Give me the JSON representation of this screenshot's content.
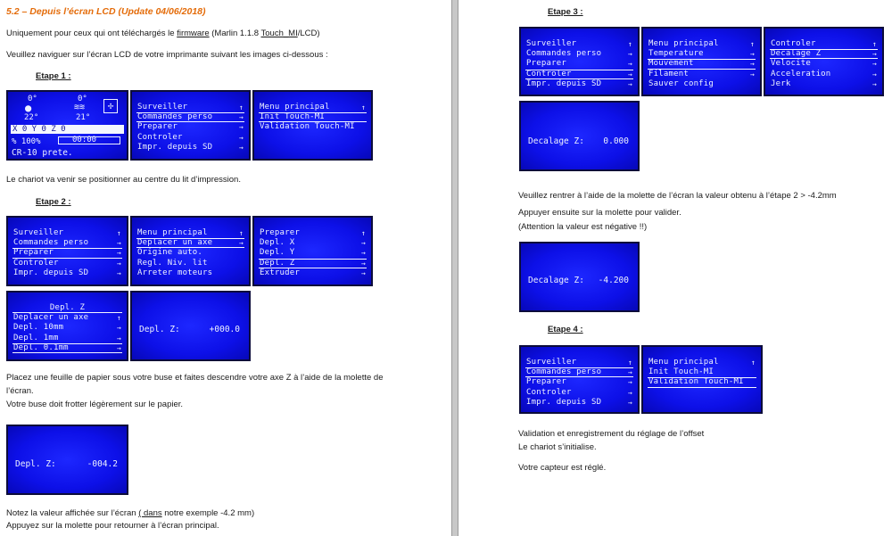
{
  "left": {
    "heading": "5.2 – Depuis l’écran LCD (Update 04/06/2018)",
    "intro_pre": "Uniquement pour ceux qui ont téléchargés le ",
    "intro_link": "firmware",
    "intro_mid": " (Marlin 1.1.8 ",
    "intro_link2": "Touch_MI",
    "intro_post": "/LCD)",
    "intro2": "Veuillez naviguer sur l’écran LCD de votre imprimante suivant les images  ci-dessous :",
    "step1": "Etape 1 :",
    "step1_note": "Le chariot va venir se positionner au centre du lit d’impression.",
    "step2": "Etape 2 :",
    "para_a1": "Placez une feuille de papier sous votre buse et faites descendre votre axe Z à l’aide de la molette de",
    "para_a2": "l’écran.",
    "para_a3": "Votre buse doit frotter légèrement sur le papier.",
    "note_pre": "Notez la valeur affichée sur  l’écran ",
    "note_link": "( dans",
    "note_post": " notre exemple -4.2 mm)",
    "note2": "Appuyez sur la molette pour retourner à l’écran principal."
  },
  "right": {
    "step3": "Etape 3 :",
    "para_b1": "Veuillez rentrer à l’aide de la molette de l’écran la valeur obtenu à l’étape 2 > -4.2mm",
    "para_b2": "Appuyer ensuite sur la molette pour valider.",
    "para_b3": "(Attention la valeur est négative !!)",
    "step4": "Etape 4 :",
    "para_c1": "Validation et enregistrement  du réglage de l’offset",
    "para_c2": "Le chariot  s’initialise.",
    "para_c3": "Votre capteur est réglé."
  },
  "screens": {
    "status": {
      "temp1": "0°",
      "temp1_target": "22°",
      "temp2": "0°",
      "temp2_target": "21°",
      "axes": "X   0 Y   0 Z  0",
      "feed": "% 100%",
      "time": "00:00",
      "message": "CR-10 prete."
    },
    "main_menu": {
      "items": [
        {
          "label": "Surveiller",
          "arrow": "↑"
        },
        {
          "label": "Commandes perso",
          "arrow": "→"
        },
        {
          "label": "Preparer",
          "arrow": "→"
        },
        {
          "label": "Controler",
          "arrow": "→"
        },
        {
          "label": "Impr. depuis SD",
          "arrow": "→"
        }
      ]
    },
    "touchmi_menu": {
      "items": [
        {
          "label": "Menu principal",
          "arrow": "↑"
        },
        {
          "label": "Init Touch-MI",
          "arrow": ""
        },
        {
          "label": "Validation Touch-MI",
          "arrow": ""
        }
      ]
    },
    "prepare_menu": {
      "items": [
        {
          "label": "Menu principal",
          "arrow": "↑"
        },
        {
          "label": "Deplacer un axe",
          "arrow": "→"
        },
        {
          "label": "Origine auto.",
          "arrow": ""
        },
        {
          "label": "Regl. Niv. lit",
          "arrow": ""
        },
        {
          "label": "Arreter moteurs",
          "arrow": ""
        }
      ]
    },
    "move_menu": {
      "items": [
        {
          "label": "Preparer",
          "arrow": "↑"
        },
        {
          "label": "Depl. X",
          "arrow": "→"
        },
        {
          "label": "Depl. Y",
          "arrow": "→"
        },
        {
          "label": "Depl. Z",
          "arrow": "→"
        },
        {
          "label": "Extruder",
          "arrow": "→"
        }
      ]
    },
    "movez_menu": {
      "items": [
        {
          "label": "Depl. Z",
          "arrow": ""
        },
        {
          "label": "Deplacer un axe",
          "arrow": "↑"
        },
        {
          "label": "Depl. 10mm",
          "arrow": "→"
        },
        {
          "label": "Depl. 1mm",
          "arrow": "→"
        },
        {
          "label": "Depl. 0.1mm",
          "arrow": "→"
        }
      ]
    },
    "deplz_edit": {
      "label": "Depl. Z:",
      "value": "+000.0"
    },
    "deplz_value": {
      "label": "Depl. Z:",
      "value": "-004.2"
    },
    "control_menu": {
      "items": [
        {
          "label": "Menu principal",
          "arrow": "↑"
        },
        {
          "label": "Temperature",
          "arrow": "→"
        },
        {
          "label": "Mouvement",
          "arrow": "→"
        },
        {
          "label": "Filament",
          "arrow": "→"
        },
        {
          "label": "Sauver config",
          "arrow": ""
        }
      ]
    },
    "motion_menu": {
      "items": [
        {
          "label": "Controler",
          "arrow": "↑"
        },
        {
          "label": "Decalage Z",
          "arrow": "→"
        },
        {
          "label": "Velocite",
          "arrow": "→"
        },
        {
          "label": "Acceleration",
          "arrow": "→"
        },
        {
          "label": "Jerk",
          "arrow": "→"
        }
      ]
    },
    "offset_zero": {
      "label": "Decalage Z:",
      "value": "0.000"
    },
    "offset_set": {
      "label": "Decalage Z:",
      "value": "-4.200"
    }
  }
}
